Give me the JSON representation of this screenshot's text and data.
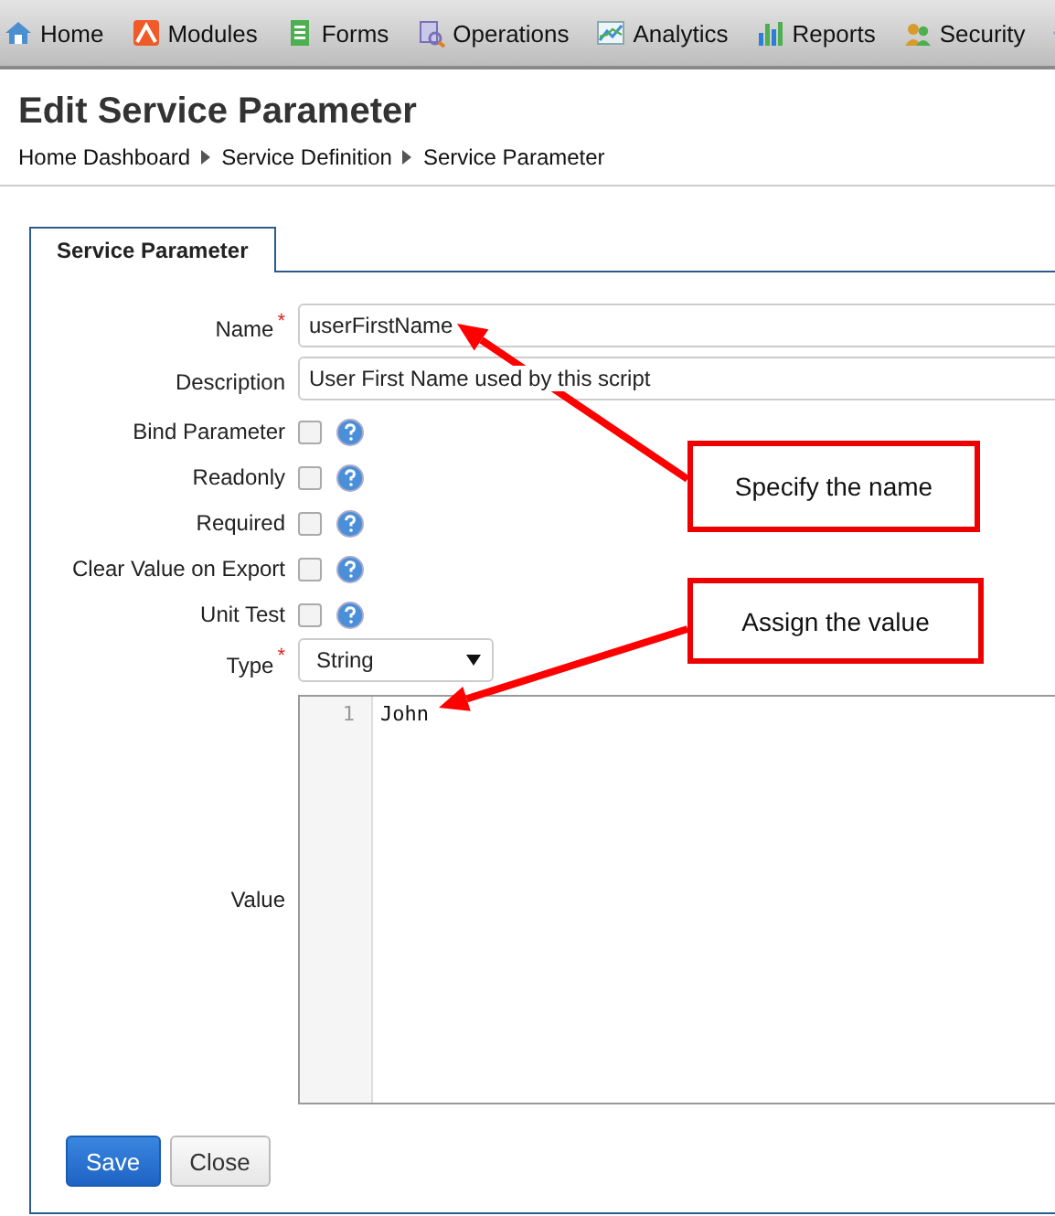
{
  "nav": [
    {
      "label": "Home",
      "kind": "home"
    },
    {
      "label": "Modules",
      "kind": "modules"
    },
    {
      "label": "Forms",
      "kind": "forms"
    },
    {
      "label": "Operations",
      "kind": "operations"
    },
    {
      "label": "Analytics",
      "kind": "analytics"
    },
    {
      "label": "Reports",
      "kind": "reports"
    },
    {
      "label": "Security",
      "kind": "security"
    }
  ],
  "title": "Edit Service Parameter",
  "breadcrumb": [
    "Home Dashboard",
    "Service Definition",
    "Service Parameter"
  ],
  "tabs": [
    {
      "label": "Service Parameter",
      "selected": true
    }
  ],
  "fields": [
    {
      "kind": "text",
      "label": "Name",
      "required_mark": "*",
      "value": "userFirstName"
    },
    {
      "kind": "text",
      "label": "Description",
      "value": "User First Name used by this script"
    },
    {
      "kind": "checkbox",
      "label": "Bind Parameter",
      "checked": false
    },
    {
      "kind": "checkbox",
      "label": "Readonly",
      "checked": false
    },
    {
      "kind": "checkbox",
      "label": "Required",
      "checked": false
    },
    {
      "kind": "checkbox",
      "label": "Clear Value on Export",
      "checked": false
    },
    {
      "kind": "checkbox",
      "label": "Unit Test",
      "checked": false
    },
    {
      "kind": "select",
      "label": "Type",
      "required_mark": "*",
      "value": "String"
    },
    {
      "kind": "code",
      "label": "Value",
      "lines": [
        {
          "number": "1",
          "text": "John"
        }
      ]
    }
  ],
  "buttons": [
    {
      "label": "Save",
      "primary": true
    },
    {
      "label": "Close",
      "primary": false
    }
  ],
  "callouts": [
    {
      "text": "Specify the name"
    },
    {
      "text": "Assign the value"
    }
  ]
}
